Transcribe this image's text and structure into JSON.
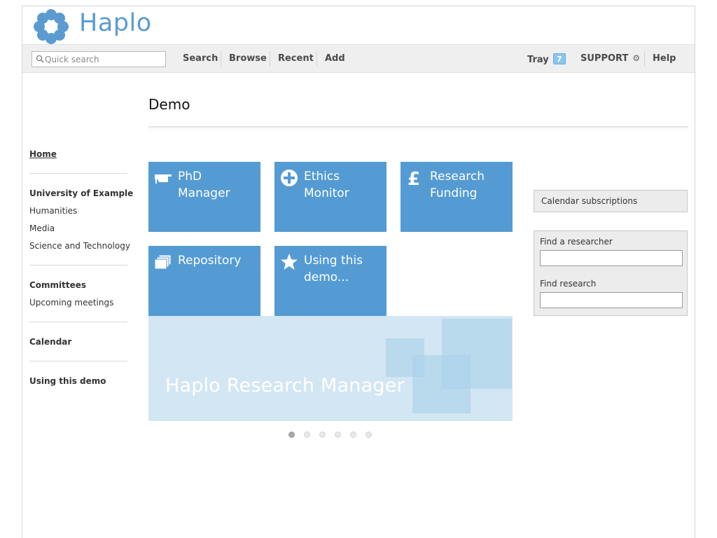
{
  "header": {
    "logo_text": "Haplo",
    "brand_color": "#5b9bd0"
  },
  "nav": {
    "search_placeholder": "Quick search",
    "search": "Search",
    "browse": "Browse",
    "recent": "Recent",
    "add": "Add",
    "tray": "Tray",
    "tray_count": "7",
    "support": "SUPPORT",
    "help": "Help"
  },
  "page": {
    "title": "Demo"
  },
  "sidebar": {
    "home": "Home",
    "university": "University of Example",
    "humanities": "Humanities",
    "media": "Media",
    "science": "Science and Technology",
    "committees": "Committees",
    "meetings": "Upcoming meetings",
    "calendar": "Calendar",
    "using_demo": "Using this demo"
  },
  "tiles": {
    "phd": "PhD Manager",
    "ethics": "Ethics Monitor",
    "funding": "Research Funding",
    "repository": "Repository",
    "using": "Using this demo..."
  },
  "banner": {
    "text": "Haplo Research Manager",
    "slide_count": 6,
    "active_slide": 1
  },
  "right_panel": {
    "calendar_subscriptions": "Calendar subscriptions",
    "find_researcher": "Find a researcher",
    "find_research": "Find research"
  },
  "colors": {
    "tile_blue": "#549bd3",
    "banner_bg": "#d3e6f3",
    "nav_bg": "#efefef"
  },
  "icons": [
    "search-icon",
    "graduation-cap-icon",
    "plus-circle-icon",
    "pound-sign-icon",
    "folders-icon",
    "star-icon",
    "gear-icon",
    "haplo-flower-logo"
  ]
}
